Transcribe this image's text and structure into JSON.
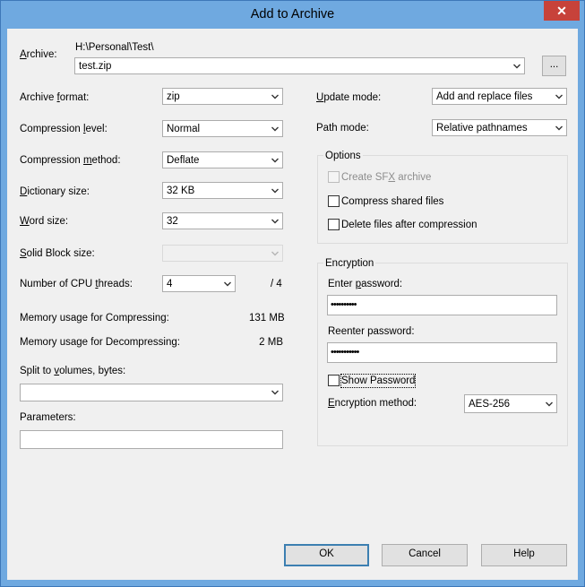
{
  "window": {
    "title": "Add to Archive",
    "close_label": "✕"
  },
  "archive": {
    "label": "Archive:",
    "path": "H:\\Personal\\Test\\",
    "value": "test.zip",
    "browse_label": "..."
  },
  "left": {
    "format": {
      "label": "Archive format:",
      "value": "zip"
    },
    "level": {
      "label": "Compression level:",
      "value": "Normal"
    },
    "method": {
      "label": "Compression method:",
      "value": "Deflate"
    },
    "dictionary": {
      "label": "Dictionary size:",
      "value": "32 KB"
    },
    "word": {
      "label": "Word size:",
      "value": "32"
    },
    "solid": {
      "label": "Solid Block size:",
      "value": ""
    },
    "threads": {
      "label": "Number of CPU threads:",
      "value": "4",
      "max": "/ 4"
    },
    "mem_compress": {
      "label": "Memory usage for Compressing:",
      "value": "131 MB"
    },
    "mem_decompress": {
      "label": "Memory usage for Decompressing:",
      "value": "2 MB"
    },
    "split": {
      "label": "Split to volumes, bytes:",
      "value": ""
    },
    "parameters": {
      "label": "Parameters:",
      "value": ""
    }
  },
  "right": {
    "update": {
      "label": "Update mode:",
      "value": "Add and replace files"
    },
    "path": {
      "label": "Path mode:",
      "value": "Relative pathnames"
    },
    "options": {
      "title": "Options",
      "sfx": "Create SFX archive",
      "shared": "Compress shared files",
      "delete": "Delete files after compression"
    },
    "encryption": {
      "title": "Encryption",
      "enter_label": "Enter password:",
      "enter_value": "••••••••••",
      "reenter_label": "Reenter password:",
      "reenter_value": "•••••••••••",
      "show_label": "Show Password",
      "method_label": "Encryption method:",
      "method_value": "AES-256"
    }
  },
  "buttons": {
    "ok": "OK",
    "cancel": "Cancel",
    "help": "Help"
  }
}
